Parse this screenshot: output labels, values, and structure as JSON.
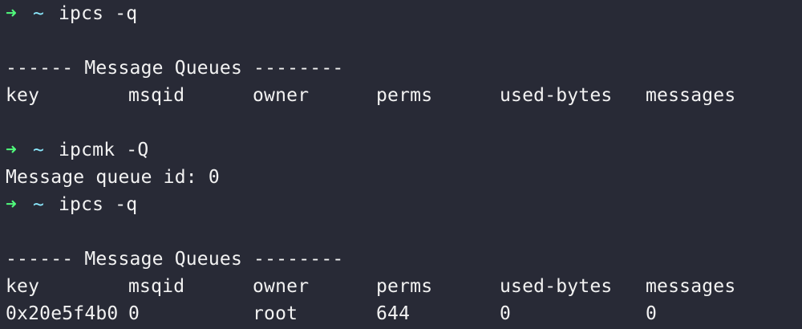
{
  "colors": {
    "background": "#282a36",
    "text": "#f2f2f2",
    "prompt_arrow": "#50fa7b",
    "prompt_tilde": "#8be9fd"
  },
  "prompt": {
    "arrow_icon": "right-arrow-icon",
    "arrow": "➜",
    "tilde": "~"
  },
  "blocks": {
    "cmd1": "ipcs -q",
    "header1": "------ Message Queues --------",
    "columns": [
      "key",
      "msqid",
      "owner",
      "perms",
      "used-bytes",
      "messages"
    ],
    "cmd2": "ipcmk -Q",
    "output2": "Message queue id: 0",
    "cmd3": "ipcs -q",
    "header2": "------ Message Queues --------",
    "row": [
      "0x20e5f4b0",
      "0",
      "root",
      "644",
      "0",
      "0"
    ]
  }
}
